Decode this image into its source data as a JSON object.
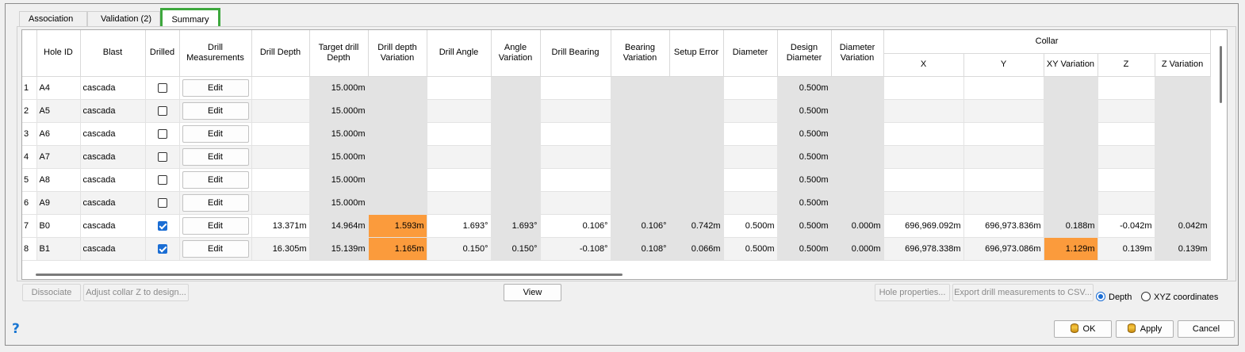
{
  "tabs": [
    {
      "label": "Association"
    },
    {
      "label": "Validation (2)"
    },
    {
      "label": "Summary"
    }
  ],
  "columns": {
    "hole_id": "Hole ID",
    "blast": "Blast",
    "drilled": "Drilled",
    "drill_measurements": "Drill Measurements",
    "drill_depth": "Drill Depth",
    "target_drill_depth": "Target drill Depth",
    "drill_depth_variation": "Drill depth Variation",
    "drill_angle": "Drill Angle",
    "angle_variation": "Angle Variation",
    "drill_bearing": "Drill Bearing",
    "bearing_variation": "Bearing Variation",
    "setup_error": "Setup Error",
    "diameter": "Diameter",
    "design_diameter": "Design Diameter",
    "diameter_variation": "Diameter Variation",
    "collar": "Collar",
    "x": "X",
    "y": "Y",
    "xy_variation": "XY Variation",
    "z": "Z",
    "z_variation": "Z Variation"
  },
  "rows": [
    {
      "num": "1",
      "hole_id": "A4",
      "blast": "cascada",
      "drilled": false,
      "edit": "Edit",
      "drill_depth": "",
      "target_depth": "15.000m",
      "depth_var": "",
      "angle": "",
      "angle_var": "",
      "bearing": "",
      "bearing_var": "",
      "setup_error": "",
      "diameter": "",
      "design_diameter": "0.500m",
      "diameter_var": "",
      "x": "",
      "y": "",
      "xy_var": "",
      "z": "",
      "z_var": ""
    },
    {
      "num": "2",
      "hole_id": "A5",
      "blast": "cascada",
      "drilled": false,
      "edit": "Edit",
      "drill_depth": "",
      "target_depth": "15.000m",
      "depth_var": "",
      "angle": "",
      "angle_var": "",
      "bearing": "",
      "bearing_var": "",
      "setup_error": "",
      "diameter": "",
      "design_diameter": "0.500m",
      "diameter_var": "",
      "x": "",
      "y": "",
      "xy_var": "",
      "z": "",
      "z_var": ""
    },
    {
      "num": "3",
      "hole_id": "A6",
      "blast": "cascada",
      "drilled": false,
      "edit": "Edit",
      "drill_depth": "",
      "target_depth": "15.000m",
      "depth_var": "",
      "angle": "",
      "angle_var": "",
      "bearing": "",
      "bearing_var": "",
      "setup_error": "",
      "diameter": "",
      "design_diameter": "0.500m",
      "diameter_var": "",
      "x": "",
      "y": "",
      "xy_var": "",
      "z": "",
      "z_var": ""
    },
    {
      "num": "4",
      "hole_id": "A7",
      "blast": "cascada",
      "drilled": false,
      "edit": "Edit",
      "drill_depth": "",
      "target_depth": "15.000m",
      "depth_var": "",
      "angle": "",
      "angle_var": "",
      "bearing": "",
      "bearing_var": "",
      "setup_error": "",
      "diameter": "",
      "design_diameter": "0.500m",
      "diameter_var": "",
      "x": "",
      "y": "",
      "xy_var": "",
      "z": "",
      "z_var": ""
    },
    {
      "num": "5",
      "hole_id": "A8",
      "blast": "cascada",
      "drilled": false,
      "edit": "Edit",
      "drill_depth": "",
      "target_depth": "15.000m",
      "depth_var": "",
      "angle": "",
      "angle_var": "",
      "bearing": "",
      "bearing_var": "",
      "setup_error": "",
      "diameter": "",
      "design_diameter": "0.500m",
      "diameter_var": "",
      "x": "",
      "y": "",
      "xy_var": "",
      "z": "",
      "z_var": ""
    },
    {
      "num": "6",
      "hole_id": "A9",
      "blast": "cascada",
      "drilled": false,
      "edit": "Edit",
      "drill_depth": "",
      "target_depth": "15.000m",
      "depth_var": "",
      "angle": "",
      "angle_var": "",
      "bearing": "",
      "bearing_var": "",
      "setup_error": "",
      "diameter": "",
      "design_diameter": "0.500m",
      "diameter_var": "",
      "x": "",
      "y": "",
      "xy_var": "",
      "z": "",
      "z_var": ""
    },
    {
      "num": "7",
      "hole_id": "B0",
      "blast": "cascada",
      "drilled": true,
      "edit": "Edit",
      "drill_depth": "13.371m",
      "target_depth": "14.964m",
      "depth_var": "1.593m",
      "depth_var_flag": true,
      "angle": "1.693°",
      "angle_var": "1.693°",
      "bearing": "0.106°",
      "bearing_var": "0.106°",
      "setup_error": "0.742m",
      "diameter": "0.500m",
      "design_diameter": "0.500m",
      "diameter_var": "0.000m",
      "x": "696,969.092m",
      "y": "696,973.836m",
      "xy_var": "0.188m",
      "z": "-0.042m",
      "z_var": "0.042m"
    },
    {
      "num": "8",
      "hole_id": "B1",
      "blast": "cascada",
      "drilled": true,
      "edit": "Edit",
      "drill_depth": "16.305m",
      "target_depth": "15.139m",
      "depth_var": "1.165m",
      "depth_var_flag": true,
      "angle": "0.150°",
      "angle_var": "0.150°",
      "bearing": "-0.108°",
      "bearing_var": "0.108°",
      "setup_error": "0.066m",
      "diameter": "0.500m",
      "design_diameter": "0.500m",
      "diameter_var": "0.000m",
      "x": "696,978.338m",
      "y": "696,973.086m",
      "xy_var": "1.129m",
      "xy_var_flag": true,
      "z": "0.139m",
      "z_var": "0.139m"
    }
  ],
  "buttons": {
    "dissociate": "Dissociate",
    "adjust_collar": "Adjust collar Z to design...",
    "view": "View",
    "hole_properties": "Hole properties...",
    "export_csv": "Export drill measurements to CSV...",
    "ok": "OK",
    "apply": "Apply",
    "cancel": "Cancel"
  },
  "radios": {
    "depth": {
      "label": "Depth",
      "selected": true
    },
    "xyz": {
      "label": "XYZ coordinates",
      "selected": false
    }
  },
  "help": "?",
  "colors": {
    "accent": "#1a6dd4",
    "highlight": "#fb9b3c",
    "tab_outline": "#3ea83e"
  }
}
